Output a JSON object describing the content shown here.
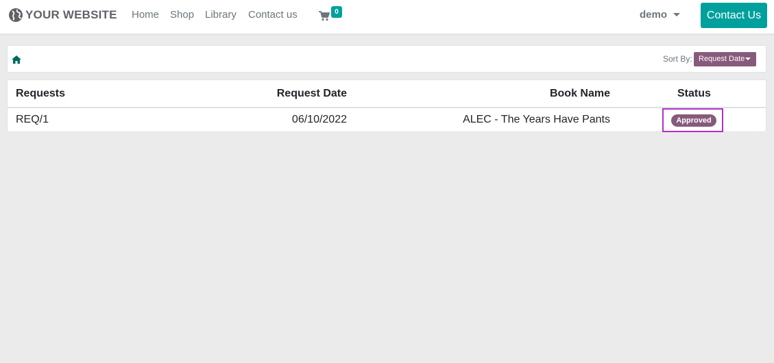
{
  "navbar": {
    "logo_text": "YOUR WEBSITE",
    "logo_icon": "globe-icon",
    "links": [
      "Home",
      "Shop",
      "Library",
      "Contact us"
    ],
    "cart_icon": "shopping-cart-icon",
    "cart_count": "0",
    "user": "demo",
    "contact_button": "Contact Us"
  },
  "toolbar": {
    "home_icon": "home-icon",
    "sort_label": "Sort By:",
    "sort_value": "Request Date"
  },
  "table": {
    "columns": [
      "Requests",
      "Request Date",
      "Book Name",
      "Status"
    ],
    "rows": [
      {
        "request": "REQ/1",
        "request_date": "06/10/2022",
        "book_name": "ALEC - The Years Have Pants",
        "status": "Approved"
      }
    ]
  },
  "colors": {
    "primary_teal": "#00a09d",
    "odoo_purple": "#875a7b",
    "highlight_border": "#b12fcc",
    "background": "#ebebeb"
  }
}
